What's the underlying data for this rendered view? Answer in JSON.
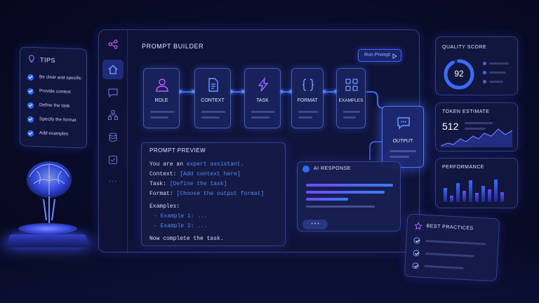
{
  "tips": {
    "title": "TIPS",
    "items": [
      "Be clear and specific",
      "Provide context",
      "Define the task",
      "Specify the format",
      "Add examples"
    ]
  },
  "builder": {
    "title": "PROMPT BUILDER",
    "run_label": "Run Prompt",
    "run_icon": "play-icon",
    "nodes": [
      {
        "label": "ROLE",
        "icon": "user-icon"
      },
      {
        "label": "CONTEXT",
        "icon": "document-icon"
      },
      {
        "label": "TASK",
        "icon": "lightning-icon"
      },
      {
        "label": "FORMAT",
        "icon": "braces-icon"
      },
      {
        "label": "EXAMPLES",
        "icon": "grid-icon"
      }
    ],
    "output": {
      "label": "OUTPUT",
      "icon": "chat-icon"
    }
  },
  "sidebar": {
    "icons": [
      "share-icon",
      "home-icon",
      "chat-icon",
      "hierarchy-icon",
      "database-icon",
      "checklist-icon",
      "more-icon"
    ],
    "more_glyph": "..."
  },
  "preview": {
    "title": "PROMPT PREVIEW",
    "lines": {
      "l1a": "You are an ",
      "l1b": "expert assistant.",
      "l2a": "Context: ",
      "l2b": "[Add context here]",
      "l3a": "Task: ",
      "l3b": "[Define the task]",
      "l4a": "Format: ",
      "l4b": "[Choose the output format]",
      "l5": "Examples:",
      "l6": "- Example 1: ...",
      "l7": "- Example 2: ...",
      "l8": "Now complete the task."
    }
  },
  "ai_response": {
    "title": "AI RESPONSE",
    "dots": "• • •"
  },
  "quality": {
    "title": "QUALITY SCORE",
    "value": "92",
    "fraction": 0.92
  },
  "token": {
    "title": "TOKEN ESTIMATE",
    "value": "512"
  },
  "performance": {
    "title": "PERFORMANCE",
    "bars": [
      0.55,
      0.25,
      0.75,
      0.45,
      0.85,
      0.35,
      0.65,
      0.5,
      0.9,
      0.4
    ]
  },
  "best_practices": {
    "title": "BEST PRACTICES"
  },
  "colors": {
    "accent": "#3b6bff",
    "purple": "#8a5cff",
    "bg": "#0a0d2b"
  }
}
